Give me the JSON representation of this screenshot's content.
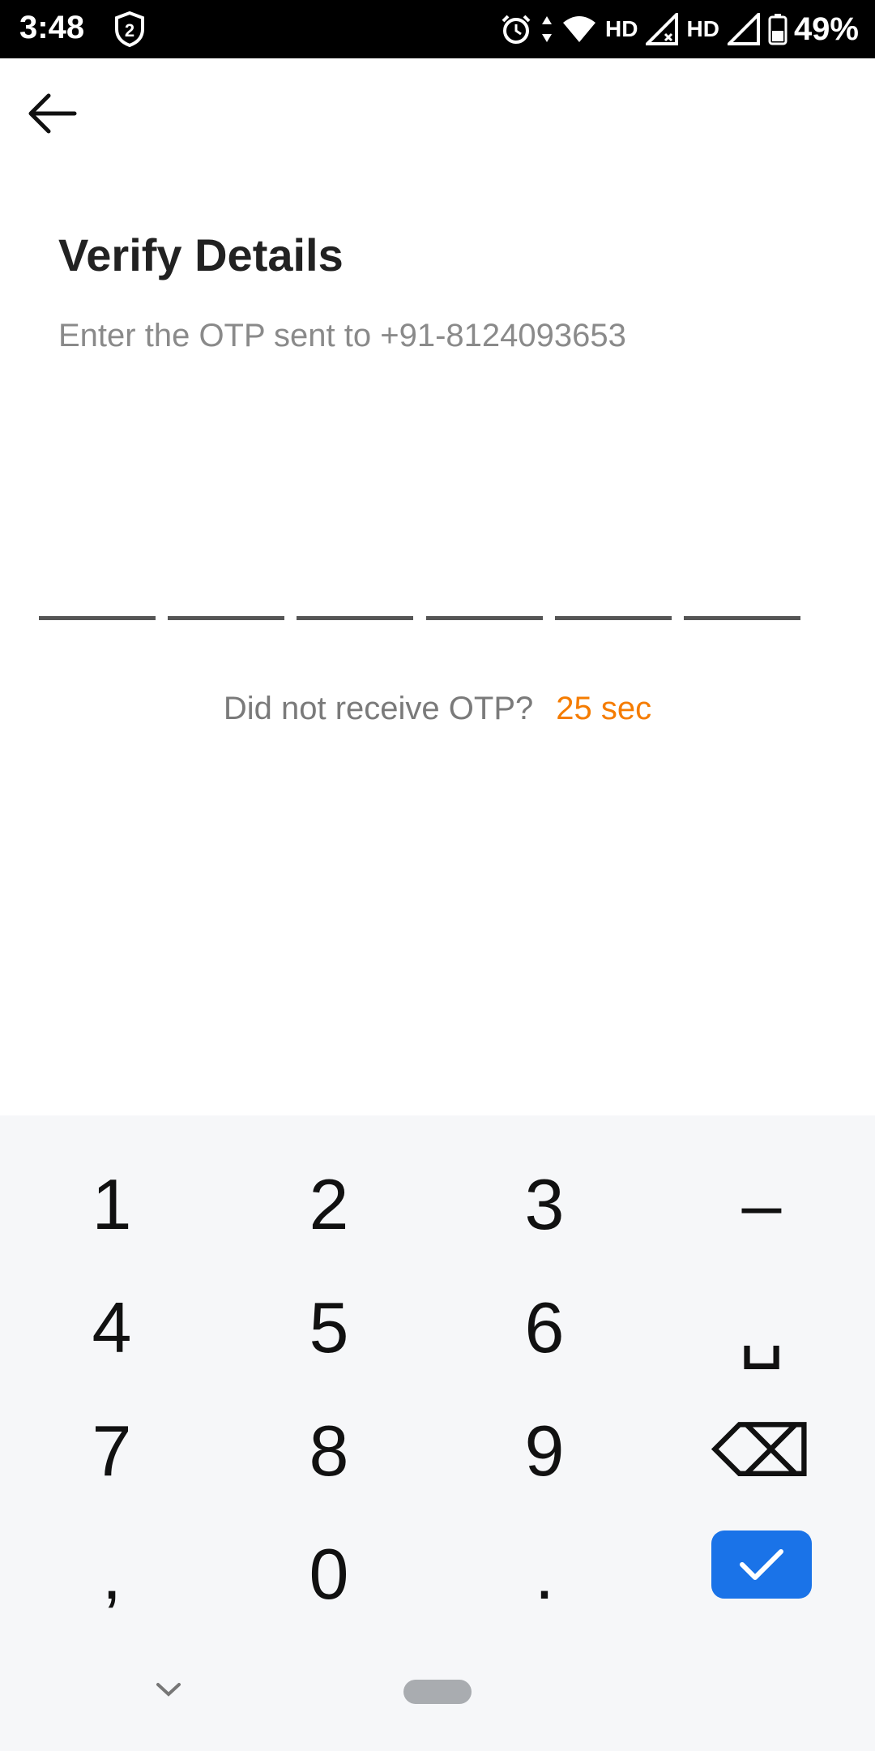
{
  "status_bar": {
    "time": "3:48",
    "notification_count": "2",
    "hd1": "HD",
    "hd2": "HD",
    "battery": "49%"
  },
  "page": {
    "title": "Verify Details",
    "subtitle": "Enter the OTP sent to +91-8124093653"
  },
  "otp": {
    "length": 6
  },
  "resend": {
    "label": "Did not receive OTP?",
    "timer": "25 sec"
  },
  "keyboard": {
    "keys": [
      "1",
      "2",
      "3",
      "–",
      "4",
      "5",
      "6",
      "␣",
      "7",
      "8",
      "9",
      "⌫",
      ",",
      "0",
      "."
    ],
    "accent": "#1a73e8"
  },
  "colors": {
    "timer": "#f57c00",
    "keyboard_bg": "#f6f7f9"
  }
}
